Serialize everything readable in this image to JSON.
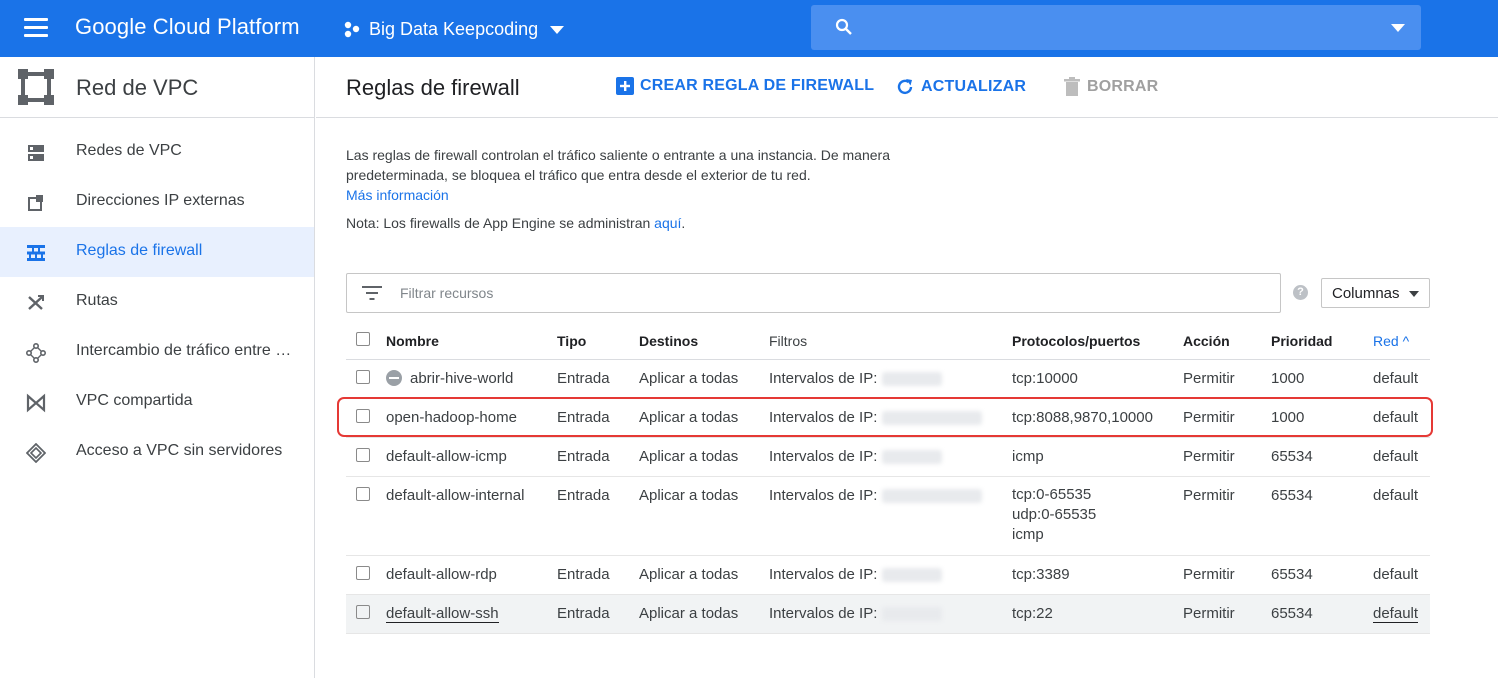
{
  "topbar": {
    "brand": "Google Cloud Platform",
    "project": "Big Data Keepcoding"
  },
  "sidebar": {
    "title": "Red de VPC",
    "items": [
      {
        "label": "Redes de VPC",
        "icon": "vpc-networks-icon"
      },
      {
        "label": "Direcciones IP externas",
        "icon": "external-ip-icon"
      },
      {
        "label": "Reglas de firewall",
        "icon": "firewall-icon",
        "active": true
      },
      {
        "label": "Rutas",
        "icon": "routes-icon"
      },
      {
        "label": "Intercambio de tráfico entre …",
        "icon": "peering-icon"
      },
      {
        "label": "VPC compartida",
        "icon": "shared-vpc-icon"
      },
      {
        "label": "Acceso a VPC sin servidores",
        "icon": "serverless-icon"
      }
    ]
  },
  "header": {
    "title": "Reglas de firewall",
    "create_label": "CREAR REGLA DE FIREWALL",
    "refresh_label": "ACTUALIZAR",
    "delete_label": "BORRAR"
  },
  "content": {
    "description": "Las reglas de firewall controlan el tráfico saliente o entrante a una instancia. De manera predeterminada, se bloquea el tráfico que entra desde el exterior de tu red.",
    "learn_more": "Más información",
    "note_prefix": "Nota: Los firewalls de App Engine se administran ",
    "note_link": "aquí",
    "note_suffix": ".",
    "filter_placeholder": "Filtrar recursos",
    "columns_label": "Columnas",
    "help_glyph": "?"
  },
  "table": {
    "headers": {
      "name": "Nombre",
      "type": "Tipo",
      "targets": "Destinos",
      "filters": "Filtros",
      "protocols": "Protocolos/puertos",
      "action": "Acción",
      "priority": "Prioridad",
      "network": "Red",
      "network_sort": "^"
    },
    "rows": [
      {
        "name": "abrir-hive-world",
        "type": "Entrada",
        "targets": "Aplicar a todas",
        "filters": "Intervalos de IP:",
        "protocols": [
          "tcp:10000"
        ],
        "action": "Permitir",
        "priority": "1000",
        "network": "default"
      },
      {
        "name": "open-hadoop-home",
        "type": "Entrada",
        "targets": "Aplicar a todas",
        "filters": "Intervalos de IP:",
        "protocols": [
          "tcp:8088,9870,10000"
        ],
        "action": "Permitir",
        "priority": "1000",
        "network": "default"
      },
      {
        "name": "default-allow-icmp",
        "type": "Entrada",
        "targets": "Aplicar a todas",
        "filters": "Intervalos de IP:",
        "protocols": [
          "icmp"
        ],
        "action": "Permitir",
        "priority": "65534",
        "network": "default"
      },
      {
        "name": "default-allow-internal",
        "type": "Entrada",
        "targets": "Aplicar a todas",
        "filters": "Intervalos de IP:",
        "protocols": [
          "tcp:0-65535",
          "udp:0-65535",
          "icmp"
        ],
        "action": "Permitir",
        "priority": "65534",
        "network": "default"
      },
      {
        "name": "default-allow-rdp",
        "type": "Entrada",
        "targets": "Aplicar a todas",
        "filters": "Intervalos de IP:",
        "protocols": [
          "tcp:3389"
        ],
        "action": "Permitir",
        "priority": "65534",
        "network": "default"
      },
      {
        "name": "default-allow-ssh",
        "type": "Entrada",
        "targets": "Aplicar a todas",
        "filters": "Intervalos de IP:",
        "protocols": [
          "tcp:22"
        ],
        "action": "Permitir",
        "priority": "65534",
        "network": "default"
      }
    ]
  },
  "colors": {
    "primary": "#1a73e8",
    "highlight_outline": "#e53935"
  }
}
